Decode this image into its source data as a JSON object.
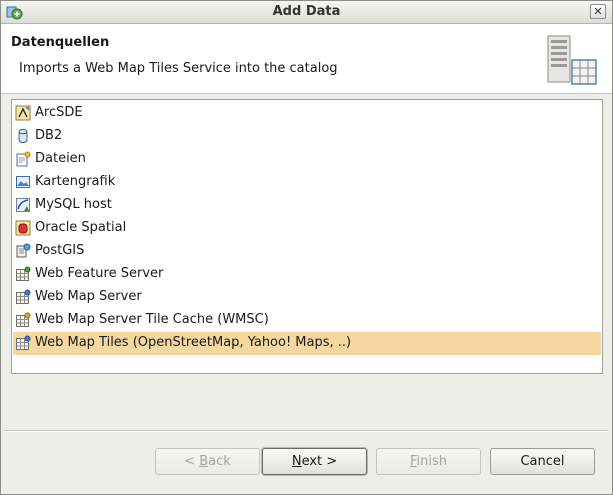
{
  "window": {
    "title": "Add Data"
  },
  "header": {
    "title": "Datenquellen",
    "description": "Imports a Web Map Tiles Service into the catalog"
  },
  "sources": [
    {
      "label": "ArcSDE",
      "icon": "arcsde-icon"
    },
    {
      "label": "DB2",
      "icon": "db2-icon"
    },
    {
      "label": "Dateien",
      "icon": "files-icon"
    },
    {
      "label": "Kartengrafik",
      "icon": "map-graphic-icon"
    },
    {
      "label": "MySQL host",
      "icon": "mysql-icon"
    },
    {
      "label": "Oracle Spatial",
      "icon": "oracle-icon"
    },
    {
      "label": "PostGIS",
      "icon": "postgis-icon"
    },
    {
      "label": "Web Feature Server",
      "icon": "wfs-icon"
    },
    {
      "label": "Web Map Server",
      "icon": "wms-icon"
    },
    {
      "label": "Web Map Server Tile Cache (WMSC)",
      "icon": "wmsc-icon"
    },
    {
      "label": "Web Map Tiles (OpenStreetMap, Yahoo! Maps, ..)",
      "icon": "wmt-icon",
      "selected": true
    }
  ],
  "buttons": {
    "back": {
      "prefix": "< ",
      "mnemonic": "B",
      "rest": "ack"
    },
    "next": {
      "prefix": "",
      "mnemonic": "N",
      "rest": "ext >"
    },
    "finish": {
      "prefix": "",
      "mnemonic": "F",
      "rest": "inish"
    },
    "cancel": "Cancel"
  },
  "colors": {
    "selection": "#f5d8a0",
    "header_bg": "#ffffff",
    "dialog_bg": "#ededea"
  }
}
